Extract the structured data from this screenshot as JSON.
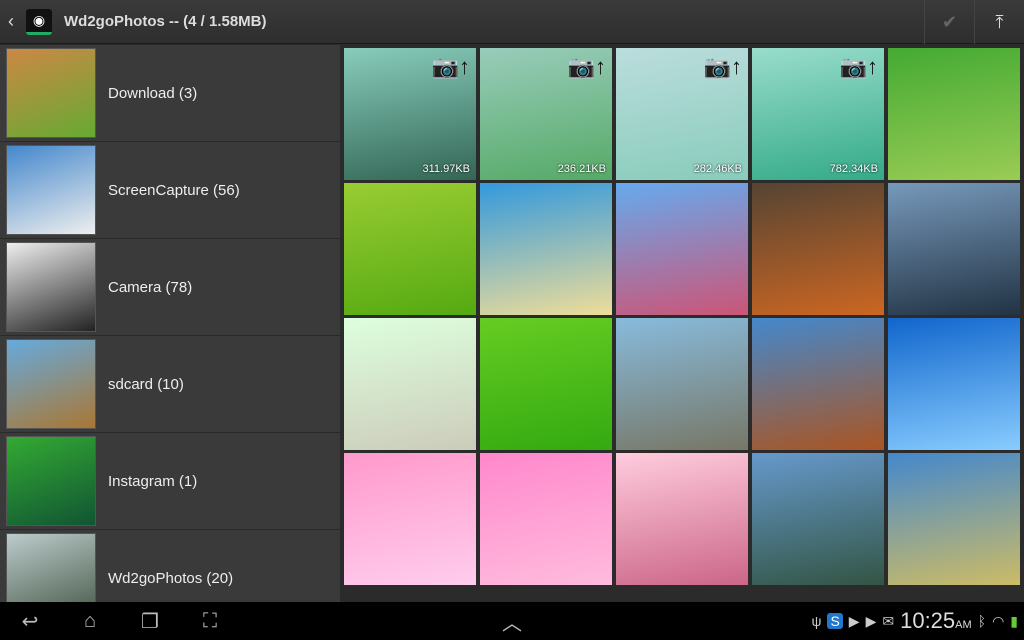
{
  "header": {
    "title": "Wd2goPhotos -- (4 / 1.58MB)",
    "back_icon": "‹",
    "check_icon": "✔",
    "upload_icon": "⤒"
  },
  "folders": [
    {
      "label": "Download (3)",
      "colors": [
        "#c84",
        "#6a3"
      ]
    },
    {
      "label": "ScreenCapture (56)",
      "colors": [
        "#48c",
        "#eee"
      ]
    },
    {
      "label": "Camera (78)",
      "colors": [
        "#eee",
        "#222"
      ]
    },
    {
      "label": "sdcard (10)",
      "colors": [
        "#6ad",
        "#a73"
      ]
    },
    {
      "label": "Instagram (1)",
      "colors": [
        "#3a3",
        "#153"
      ]
    },
    {
      "label": "Wd2goPhotos (20)",
      "colors": [
        "#bcc",
        "#454"
      ]
    }
  ],
  "tiles": [
    {
      "colors": [
        "#8cb",
        "#365"
      ],
      "size": "311.97KB",
      "upload": true
    },
    {
      "colors": [
        "#9cb",
        "#5a6"
      ],
      "size": "236.21KB",
      "upload": true
    },
    {
      "colors": [
        "#bdd",
        "#8cb"
      ],
      "size": "282.46KB",
      "upload": true
    },
    {
      "colors": [
        "#9dc",
        "#3a8"
      ],
      "size": "782.34KB",
      "upload": true
    },
    {
      "colors": [
        "#4a3",
        "#9c5"
      ]
    },
    {
      "colors": [
        "#9c3",
        "#5a1"
      ]
    },
    {
      "colors": [
        "#39d",
        "#ed9"
      ]
    },
    {
      "colors": [
        "#6ae",
        "#c57"
      ]
    },
    {
      "colors": [
        "#543",
        "#c62"
      ]
    },
    {
      "colors": [
        "#79b",
        "#234"
      ]
    },
    {
      "colors": [
        "#dfd",
        "#ccb"
      ]
    },
    {
      "colors": [
        "#6c2",
        "#3a1"
      ]
    },
    {
      "colors": [
        "#8bd",
        "#776"
      ]
    },
    {
      "colors": [
        "#48c",
        "#a52"
      ]
    },
    {
      "colors": [
        "#16c",
        "#8cf"
      ]
    },
    {
      "colors": [
        "#f9c",
        "#fce"
      ]
    },
    {
      "colors": [
        "#f8c",
        "#fbd"
      ]
    },
    {
      "colors": [
        "#fcd",
        "#c68"
      ]
    },
    {
      "colors": [
        "#69c",
        "#354"
      ]
    },
    {
      "colors": [
        "#48c",
        "#cb6"
      ]
    }
  ],
  "upload_icon_label": "📷↑",
  "status": {
    "time": "10:25",
    "ampm": "AM",
    "icons": [
      "usb-icon",
      "s-app-icon",
      "play-store-icon",
      "play-store-icon",
      "gmail-icon",
      "bluetooth-icon",
      "wifi-icon",
      "battery-icon"
    ]
  }
}
